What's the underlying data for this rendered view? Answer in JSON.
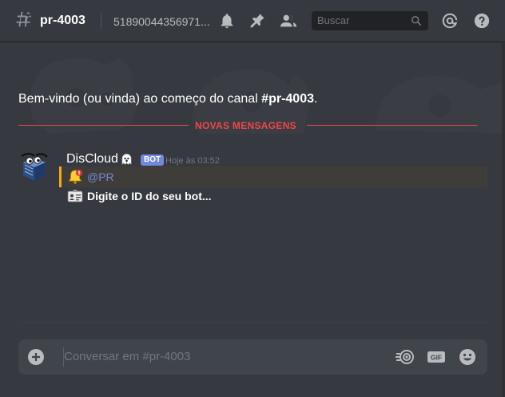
{
  "header": {
    "channel_name": "pr-4003",
    "topic": "51890044356971...",
    "search_placeholder": "Buscar",
    "icons": [
      "hash-icon",
      "bell-icon",
      "pin-icon",
      "members-icon",
      "search-icon",
      "at-icon",
      "help-icon"
    ]
  },
  "messages": {
    "welcome_prefix": "Bem-vindo (ou vinda) ao começo do canal ",
    "welcome_channel": "#pr-4003",
    "welcome_suffix": ".",
    "new_messages_label": "NOVAS MENSAGENS",
    "post": {
      "author": "DisCloud",
      "bot_tag": "BOT",
      "timestamp": "Hoje às 03:52",
      "mention": "@PR",
      "prompt": "Digite o ID do seu bot..."
    }
  },
  "composer": {
    "placeholder": "Conversar em #pr-4003",
    "gif_label": "GIF"
  },
  "colors": {
    "background": "#36393f",
    "accent": "#7289da",
    "new_messages": "#f04747",
    "mention_bar": "#faa61a"
  }
}
